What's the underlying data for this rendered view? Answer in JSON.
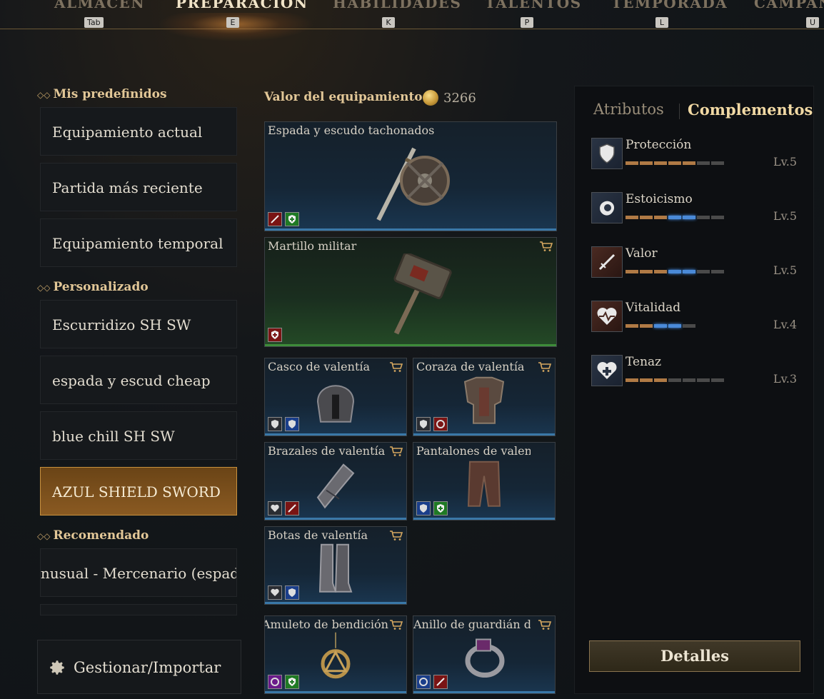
{
  "nav": {
    "tabs": [
      {
        "label": "ALMACÉN",
        "key": "Tab"
      },
      {
        "label": "PREPARACIÓN",
        "key": "E"
      },
      {
        "label": "HABILIDADES",
        "key": "K"
      },
      {
        "label": "TALENTOS",
        "key": "P"
      },
      {
        "label": "TEMPORADA",
        "key": "L"
      },
      {
        "label": "CAMPAÑA",
        "key": "U"
      }
    ]
  },
  "presets": {
    "mine_header": "Mis predefinidos",
    "mine": [
      "Equipamiento actual",
      "Partida más reciente",
      "Equipamiento temporal"
    ],
    "custom_header": "Personalizado",
    "custom": [
      "Escurridizo SH SW",
      "espada y escud cheap",
      "blue chill SH SW",
      "AZUL SHIELD SWORD"
    ],
    "recommended_header": "Recomendado",
    "recommended": [
      "Inusual - Mercenario (espada"
    ],
    "manage_label": "Gestionar/Importar"
  },
  "equipment": {
    "value_label": "Valor del equipamiento",
    "value": "3266",
    "items": [
      {
        "name": "Espada y escudo tachonados"
      },
      {
        "name": "Martillo militar"
      },
      {
        "name": "Casco de valentía"
      },
      {
        "name": "Coraza de valentía"
      },
      {
        "name": "Brazales de valentía"
      },
      {
        "name": "Pantalones de valentía"
      },
      {
        "name": "Botas de valentía"
      },
      {
        "name": "Amuleto de bendición"
      },
      {
        "name": "Anillo de guardián de"
      }
    ]
  },
  "panel": {
    "tab_attributes": "Atributos",
    "tab_complements": "Complementos",
    "attributes": [
      {
        "name": "Protección",
        "level": "Lv.5",
        "filled": 5,
        "blue": 0,
        "total": 7
      },
      {
        "name": "Estoicismo",
        "level": "Lv.5",
        "filled": 3,
        "blue": 2,
        "total": 7
      },
      {
        "name": "Valor",
        "level": "Lv.5",
        "filled": 3,
        "blue": 2,
        "total": 7
      },
      {
        "name": "Vitalidad",
        "level": "Lv.4",
        "filled": 2,
        "blue": 2,
        "total": 5
      },
      {
        "name": "Tenaz",
        "level": "Lv.3",
        "filled": 3,
        "blue": 0,
        "total": 7
      }
    ],
    "details_label": "Detalles"
  },
  "colors": {
    "accent_gold": "#e2c797",
    "selected_preset": "#8a5a22",
    "blue_rarity": "#3a78a8",
    "green_rarity": "#3e8c3a"
  }
}
